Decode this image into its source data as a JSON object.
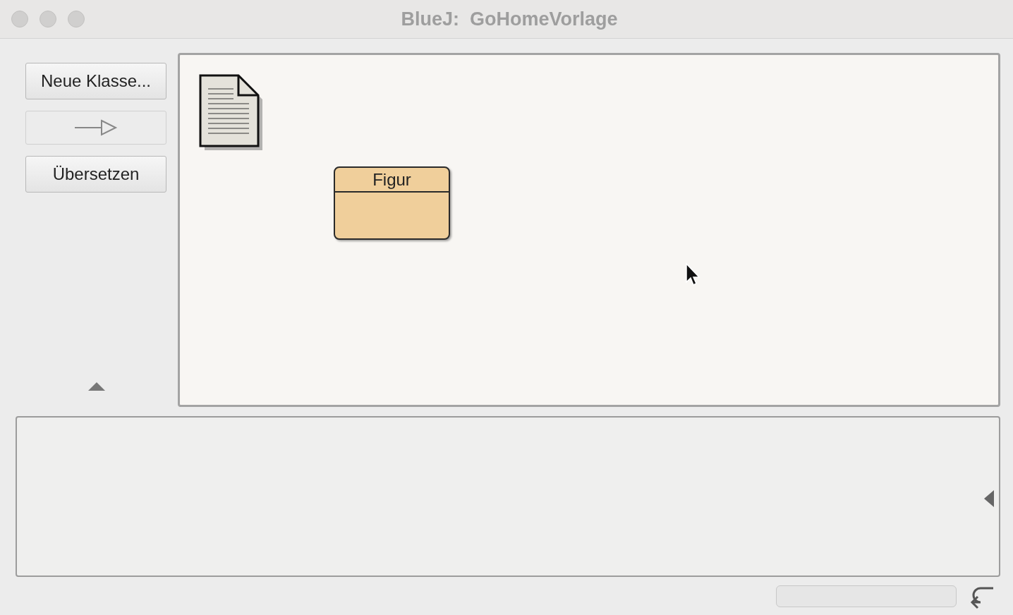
{
  "window": {
    "title": "BlueJ:  GoHomeVorlage"
  },
  "toolbar": {
    "buttons": [
      {
        "kind": "text",
        "label": "Neue Klasse..."
      },
      {
        "kind": "arrow",
        "disabled": true
      },
      {
        "kind": "text",
        "label": "Übersetzen"
      }
    ]
  },
  "diagram": {
    "items": [
      {
        "kind": "readme"
      },
      {
        "kind": "class",
        "name": "Figur"
      }
    ]
  }
}
